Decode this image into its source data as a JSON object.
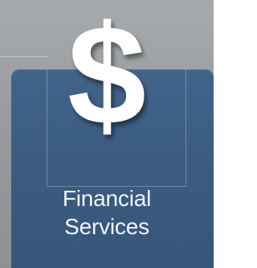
{
  "tile": {
    "label_line1": "Financial",
    "label_line2": "Services",
    "icon": "dollar-icon",
    "colors": {
      "background": "#9b9fa2",
      "tile": "#3d5e82",
      "text": "#f2f5f8"
    }
  }
}
